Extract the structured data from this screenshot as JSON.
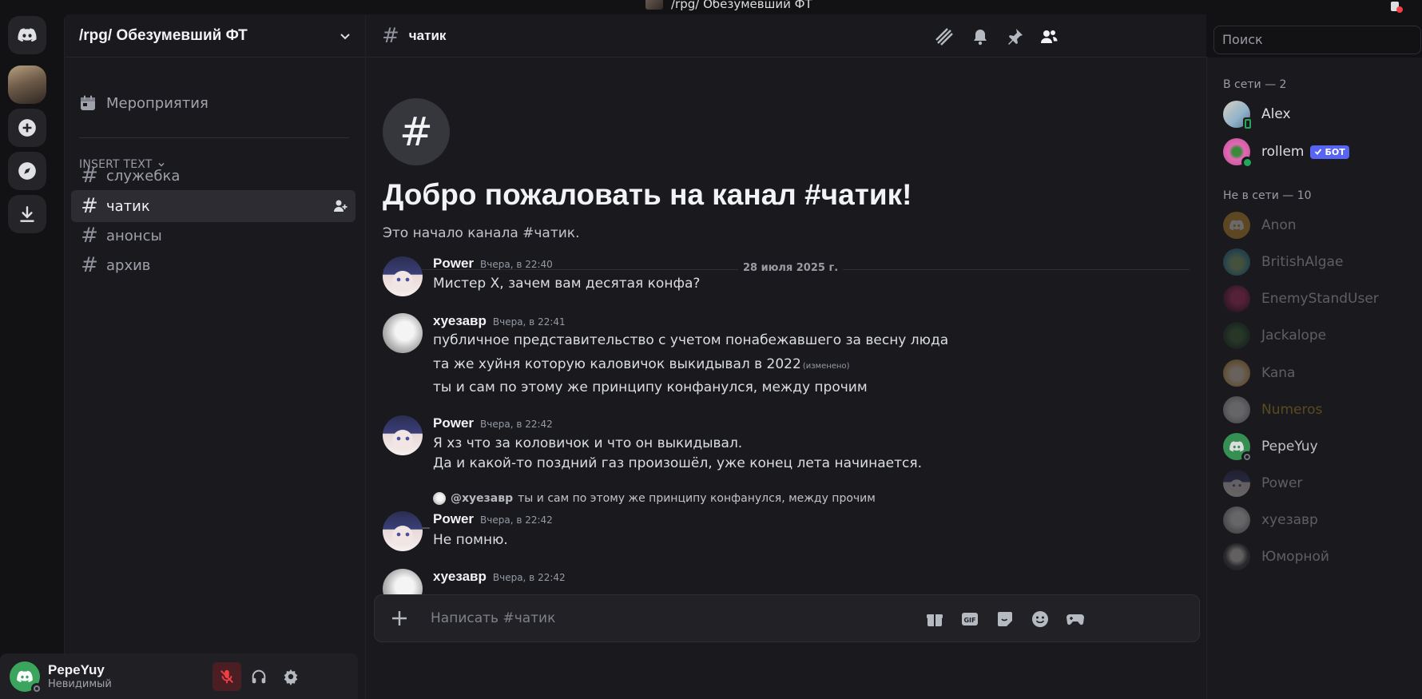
{
  "window": {
    "title": "/rpg/ Обезумевший ФТ"
  },
  "guild": {
    "name": "/rpg/ Обезумевший ФТ",
    "events_label": "Мероприятия"
  },
  "category": {
    "name": "INSERT TEXT"
  },
  "channels": [
    {
      "name": "служебка",
      "active": false
    },
    {
      "name": "чатик",
      "active": true
    },
    {
      "name": "анонсы",
      "active": false
    },
    {
      "name": "архив",
      "active": false
    }
  ],
  "user": {
    "name": "PepeYuy",
    "status": "Невидимый"
  },
  "header": {
    "channel": "чатик",
    "search_placeholder": "Поиск"
  },
  "welcome": {
    "title": "Добро пожаловать на канал #чатик!",
    "subtitle": "Это начало канала #чатик."
  },
  "date_divider": "28 июля 2025 г.",
  "messages": [
    {
      "author": "Power",
      "time": "Вчера, в 22:40",
      "lines": [
        "Мистер X, зачем вам десятая конфа?"
      ]
    },
    {
      "author": "хуезавр",
      "time": "Вчера, в 22:41",
      "lines": [
        "публичное представительство с учетом понабежавшего за весну люда",
        "та же хуйня которую каловичок выкидывал в 2022",
        "ты и сам по этому же принципу конфанулся, между прочим"
      ],
      "edited": "(изменено)"
    },
    {
      "author": "Power",
      "time": "Вчера, в 22:42",
      "lines": [
        "Я хз что за коловичок и что он выкидывал.",
        "Да и какой-то поздний газ произошёл, уже конец лета начинается."
      ]
    },
    {
      "author": "Power",
      "time": "Вчера, в 22:42",
      "lines": [
        "Не помню."
      ],
      "reply": {
        "name": "@хуезавр",
        "text": "ты и сам по этому же принципу конфанулся, между прочим"
      }
    },
    {
      "author": "хуезавр",
      "time": "Вчера, в 22:42",
      "lines": []
    }
  ],
  "composer": {
    "placeholder": "Написать #чатик",
    "gif_label": "GIF"
  },
  "members": {
    "online_header": "В сети — 2",
    "offline_header": "Не в сети — 10",
    "online": [
      {
        "name": "Alex"
      },
      {
        "name": "rollem",
        "badge": "БОТ"
      }
    ],
    "offline": [
      {
        "name": "Anon"
      },
      {
        "name": "BritishAlgae"
      },
      {
        "name": "EnemyStandUser"
      },
      {
        "name": "Jackalope"
      },
      {
        "name": "Kana"
      },
      {
        "name": "Numeros"
      },
      {
        "name": "PepeYuy"
      },
      {
        "name": "Power"
      },
      {
        "name": "хуезавр"
      },
      {
        "name": "Юморной"
      }
    ]
  },
  "colors": {
    "accent": "#5865f2",
    "online": "#23a55a",
    "numeros": "#c9a227",
    "background": "#1a1a1e"
  }
}
